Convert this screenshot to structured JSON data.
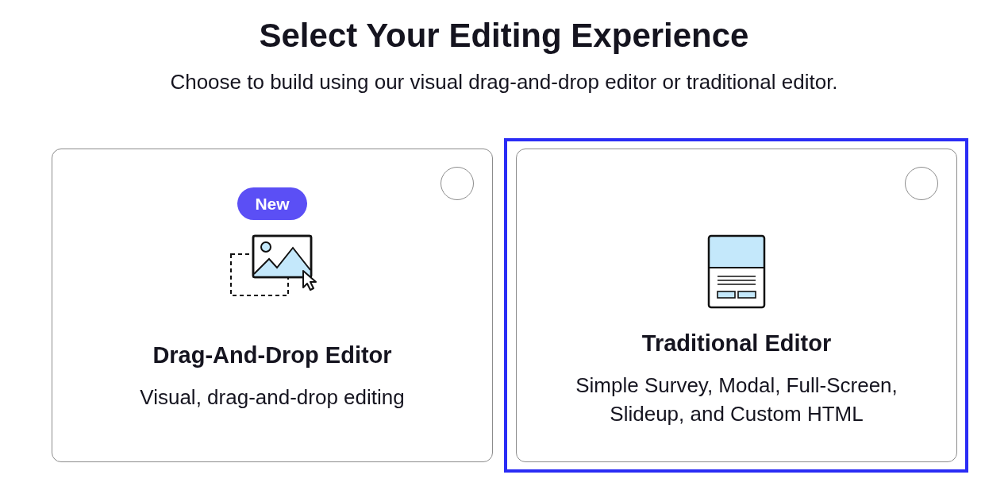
{
  "heading": "Select Your Editing Experience",
  "subheading": "Choose to build using our visual drag-and-drop editor or traditional editor.",
  "options": [
    {
      "kind": "drag_and_drop",
      "badge": "New",
      "title": "Drag-And-Drop Editor",
      "description": "Visual, drag-and-drop editing",
      "selected": false,
      "focused": false
    },
    {
      "kind": "traditional",
      "title": "Traditional Editor",
      "description": "Simple Survey, Modal, Full-Screen, Slideup, and Custom HTML",
      "selected": false,
      "focused": true
    }
  ]
}
